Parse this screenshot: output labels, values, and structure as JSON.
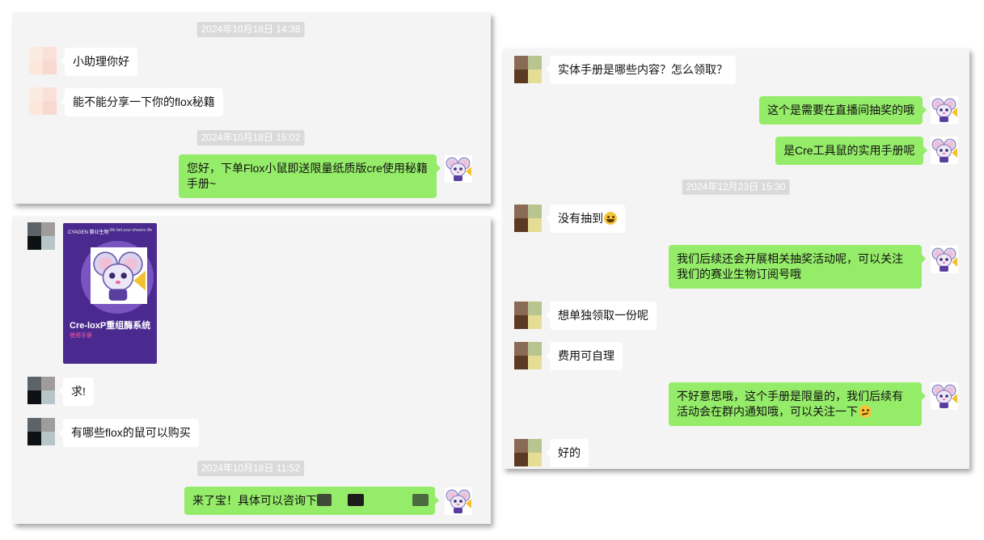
{
  "panel1": {
    "timestamps": [
      "2024年10月18日 14:38",
      "2024年10月18日 15:02"
    ],
    "messages": [
      {
        "from": "user",
        "text": "小助理你好"
      },
      {
        "from": "user",
        "text": "能不能分享一下你的flox秘籍"
      },
      {
        "from": "assistant",
        "text": "您好，下单Flox小鼠即送限量纸质版cre使用秘籍手册~"
      }
    ]
  },
  "panel2": {
    "timestamps": [
      "2024年10月18日 11:52"
    ],
    "image_card": {
      "brand": "CYAGEN 赛业生物",
      "tagline": "We bet your dreams life",
      "title": "Cre-loxP重组酶系统",
      "subtitle": "使用手册"
    },
    "messages": [
      {
        "from": "user",
        "text": "求!"
      },
      {
        "from": "user",
        "text": "有哪些flox的鼠可以购买"
      },
      {
        "from": "assistant",
        "text": "来了宝！具体可以咨询下"
      }
    ]
  },
  "panel3": {
    "timestamps": [
      "2024年12月23日 15:30"
    ],
    "messages": [
      {
        "from": "user",
        "text": "实体手册是哪些内容？怎么领取？"
      },
      {
        "from": "assistant",
        "text": "这个是需要在直播间抽奖的哦"
      },
      {
        "from": "assistant",
        "text": "是Cre工具鼠的实用手册呢"
      },
      {
        "from": "user",
        "text": "没有抽到",
        "emoji": "laughing-crying-emoji"
      },
      {
        "from": "assistant",
        "text": "我们后续还会开展相关抽奖活动呢，可以关注我们的赛业生物订阅号哦"
      },
      {
        "from": "user",
        "text": "想单独领取一份呢"
      },
      {
        "from": "user",
        "text": "费用可自理"
      },
      {
        "from": "assistant",
        "text": "不好意思哦，这个手册是限量的，我们后续有活动会在群内通知哦，可以关注一下",
        "emoji": "thinking-emoji"
      },
      {
        "from": "user",
        "text": "好的"
      }
    ]
  },
  "colors": {
    "panel_bg": "#f4f4f4",
    "outgoing_bubble": "#95ec69",
    "incoming_bubble": "#ffffff",
    "timestamp_bg": "#dadada"
  }
}
